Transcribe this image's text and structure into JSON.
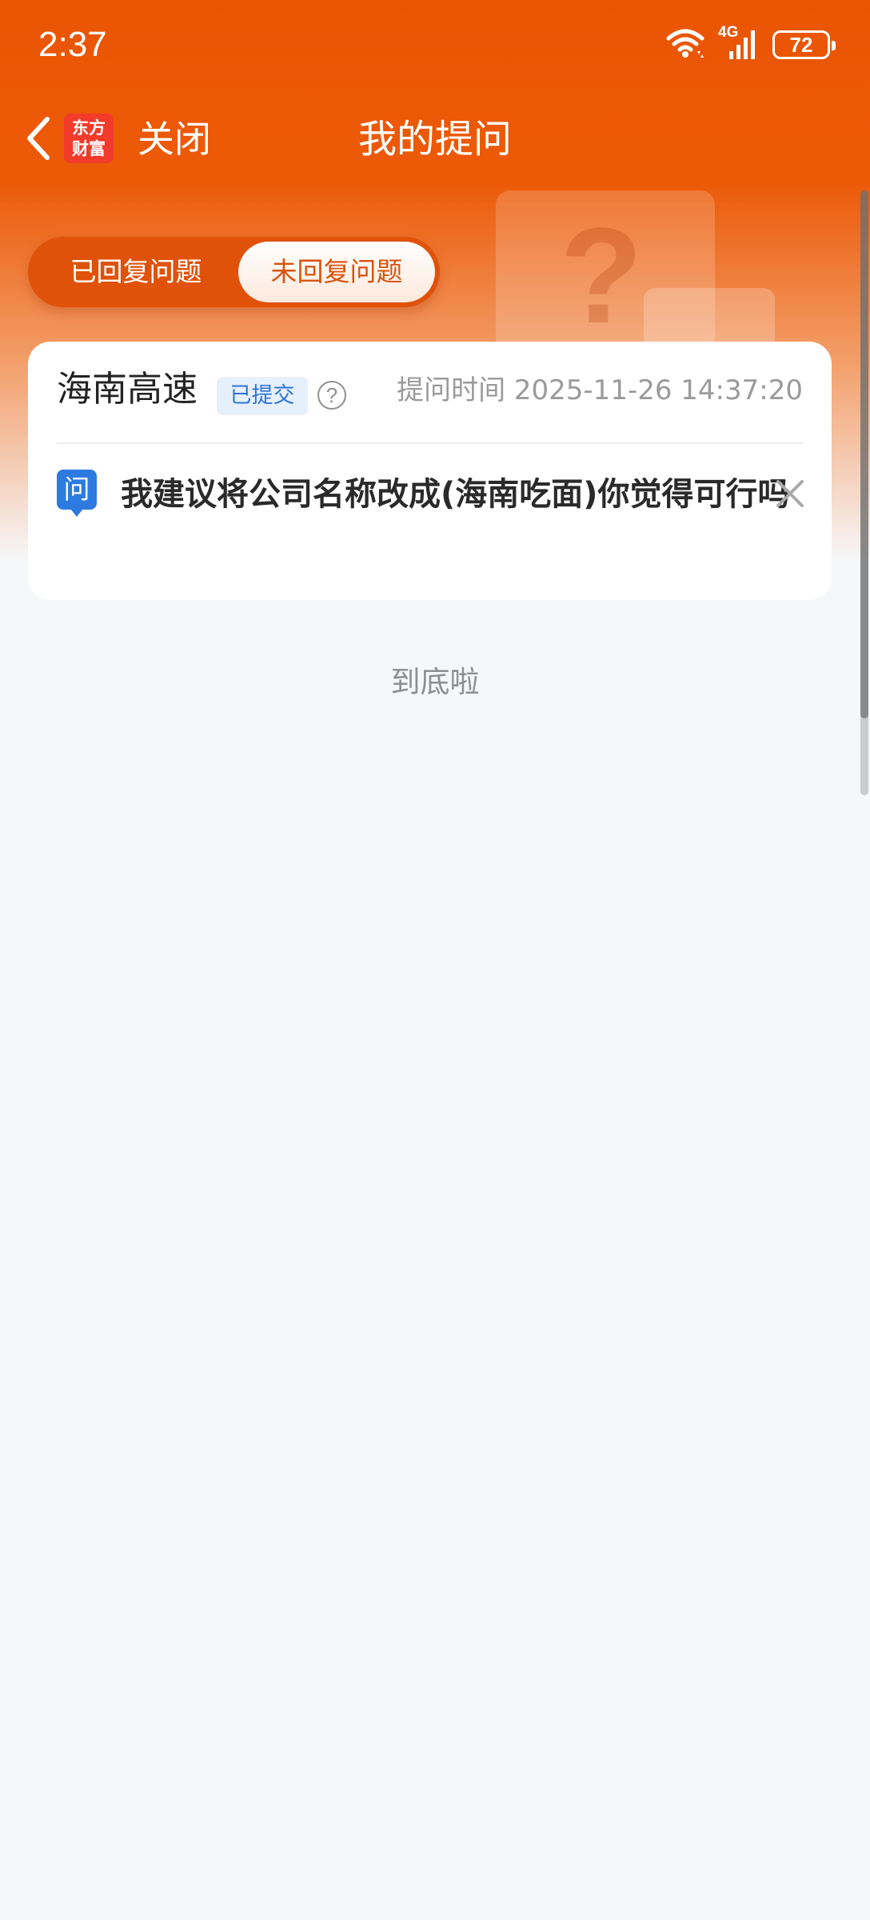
{
  "status_bar": {
    "time": "2:37",
    "network": "4G",
    "battery": "72"
  },
  "nav": {
    "logo_line1": "东方",
    "logo_line2": "财富",
    "close_label": "关闭",
    "title": "我的提问"
  },
  "tabs": [
    {
      "label": "已回复问题",
      "selected": false
    },
    {
      "label": "未回复问题",
      "selected": true
    }
  ],
  "questions": [
    {
      "stock_name": "海南高速",
      "status": "已提交",
      "time_label": "提问时间",
      "time_value": "2025-11-26 14:37:20",
      "icon_text": "问",
      "question": "我建议将公司名称改成(海南吃面)你觉得可行吗"
    }
  ],
  "footer": {
    "end_text": "到底啦"
  },
  "colors": {
    "brand_orange": "#ea5504",
    "accent_blue": "#2d7be0",
    "logo_red": "#f23b2a"
  },
  "icons": [
    "wifi-icon",
    "cellular-signal-icon",
    "battery-icon",
    "back-arrow-icon",
    "help-icon",
    "question-icon",
    "close-x-icon"
  ]
}
